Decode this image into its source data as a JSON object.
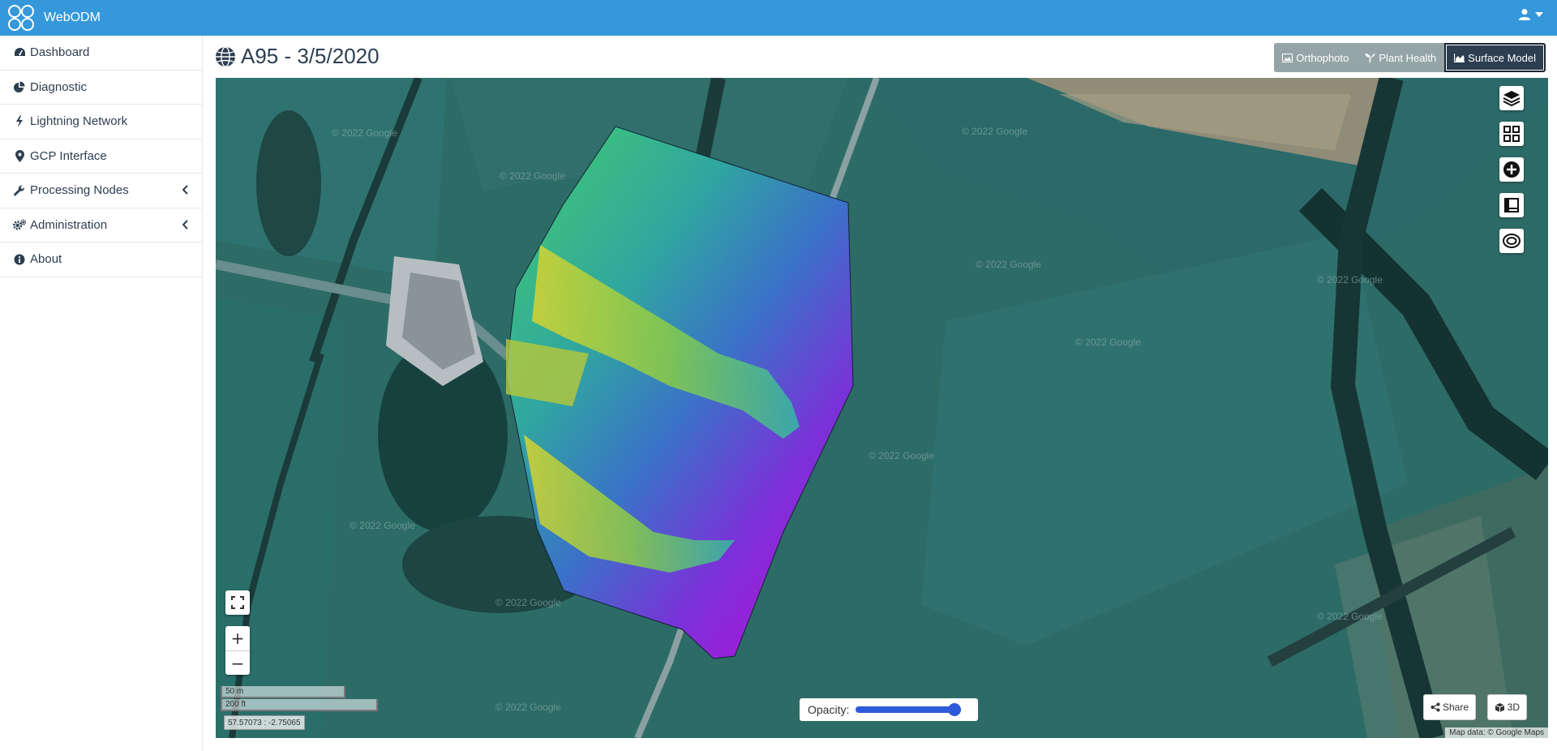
{
  "app": {
    "brand": "WebODM"
  },
  "sidebar": {
    "items": [
      {
        "label": "Dashboard",
        "icon": "dashboard-icon"
      },
      {
        "label": "Diagnostic",
        "icon": "pie-chart-icon"
      },
      {
        "label": "Lightning Network",
        "icon": "bolt-icon"
      },
      {
        "label": "GCP Interface",
        "icon": "map-marker-icon"
      },
      {
        "label": "Processing Nodes",
        "icon": "wrench-icon"
      },
      {
        "label": "Administration",
        "icon": "cogs-icon"
      },
      {
        "label": "About",
        "icon": "info-icon"
      }
    ]
  },
  "page": {
    "title": "A95 - 3/5/2020"
  },
  "layer_buttons": {
    "orthophoto": "Orthophoto",
    "plant_health": "Plant Health",
    "surface_model": "Surface Model",
    "active": "Surface Model"
  },
  "map": {
    "scale_metric": "50 m",
    "scale_imperial": "200 ft",
    "coordinates": "57.57073 : -2.75065",
    "opacity_label": "Opacity:",
    "opacity_value": 1.0,
    "share_label": "Share",
    "three_d_label": "3D",
    "attribution": "Map data: © Google Maps",
    "watermark": "© 2022 Google"
  },
  "colors": {
    "navbar": "#3498db",
    "active_button": "#2c3e50",
    "inactive_button": "#95a5a6"
  }
}
